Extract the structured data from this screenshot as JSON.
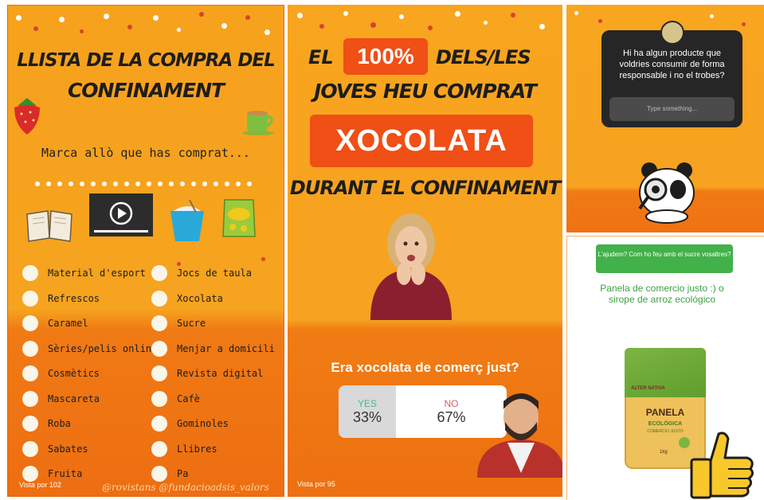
{
  "panel1": {
    "title_line1": "LLISTA DE LA COMPRA DEL",
    "title_line2": "CONFINAMENT",
    "subtitle": "Marca allò que has comprat...",
    "icons": [
      "book-icon",
      "video-player-icon",
      "takeaway-box-icon",
      "snack-bag-icon",
      "strawberry-icon",
      "coffee-cup-icon"
    ],
    "left_items": [
      "Material d'esport",
      "Refrescos",
      "Caramel",
      "Sèries/pelis online",
      "Cosmètics",
      "Mascareta",
      "Roba",
      "Sabates",
      "Fruita"
    ],
    "right_items": [
      "Jocs de taula",
      "Xocolata",
      "Sucre",
      "Menjar a domicili",
      "Revista digital",
      "Cafè",
      "Gominoles",
      "Llibres",
      "Pa"
    ],
    "views": "Vista por 102",
    "watermark": "@rovistans @fundacioadsis_valors"
  },
  "panel2": {
    "line1_pre": "EL",
    "line1_pill": "100%",
    "line1_post": "DELS/LES",
    "line2": "JOVES HEU COMPRAT",
    "pill_big": "XOCOLATA",
    "line3": "DURANT EL CONFINAMENT",
    "question": "Era xocolata de comerç just?",
    "poll": {
      "yes_label": "YES",
      "yes_pct": "33%",
      "yes_color": "#3bbf8f",
      "no_label": "NO",
      "no_pct": "67%",
      "no_color": "#e45b5b"
    },
    "views": "Vista por 95"
  },
  "panel3": {
    "question": "Hi ha algun producte que voldries consumir de forma responsable i no el trobes?",
    "input_placeholder": "Type something..."
  },
  "panel4": {
    "prompt": "L'ajudem? Com ho feu amb el sucre vosaltres?",
    "answer": "Panela de comercio justo :)  o sirope de arroz ecológico",
    "product_brand": "ALTER NATIVA",
    "product_name": "PANELA",
    "product_sub1": "ECOLÓGICA",
    "product_sub2": "COMERCIO JUSTO",
    "product_weight": "1kg",
    "answer_color": "#3fa043"
  },
  "colors": {
    "orange": "#f7a21d",
    "accent": "#f04f16",
    "green": "#3fa043"
  }
}
